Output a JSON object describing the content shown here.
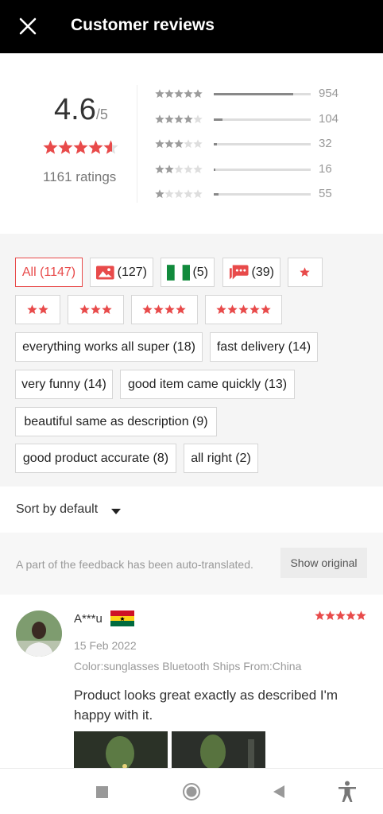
{
  "header": {
    "title": "Customer reviews",
    "close_icon": "close-icon"
  },
  "summary": {
    "score": "4.6",
    "score_suffix": "/5",
    "stars_value": 4.6,
    "ratings_label": "1161 ratings",
    "distribution": [
      {
        "stars": 5,
        "count": "954",
        "fraction": 0.82
      },
      {
        "stars": 4,
        "count": "104",
        "fraction": 0.09
      },
      {
        "stars": 3,
        "count": "32",
        "fraction": 0.03
      },
      {
        "stars": 2,
        "count": "16",
        "fraction": 0.015
      },
      {
        "stars": 1,
        "count": "55",
        "fraction": 0.048
      }
    ]
  },
  "filters": {
    "all": "All (1147)",
    "photos": "(127)",
    "country": "(5)",
    "comments": "(39)",
    "tags": [
      "everything works all super (18)",
      "fast delivery (14)",
      "very funny (14)",
      "good item came quickly (13)",
      "beautiful same as description (9)",
      "good product accurate (8)",
      "all right (2)"
    ]
  },
  "sort": {
    "label": "Sort by default"
  },
  "translation": {
    "note": "A part of the feedback has been auto-translated.",
    "button": "Show original"
  },
  "review": {
    "name": "A***u",
    "date": "15 Feb 2022",
    "meta": "Color:sunglasses Bluetooth Ships From:China",
    "text": "Product looks great exactly as described I'm happy with it.",
    "stars": 5
  },
  "colors": {
    "accent": "#e84a4a",
    "star_gray": "#c8c8c8",
    "header_bg": "#000000"
  },
  "navbar": [
    "recents-icon",
    "home-icon",
    "back-icon",
    "accessibility-icon"
  ]
}
